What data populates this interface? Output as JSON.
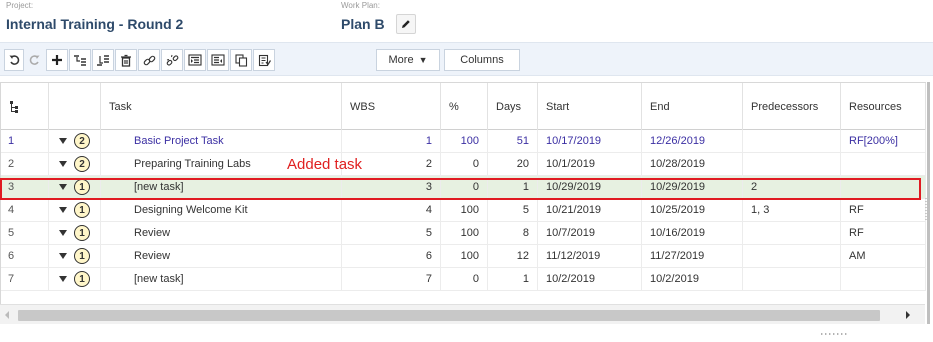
{
  "header": {
    "project_label": "Project:",
    "project_name": "Internal Training - Round 2",
    "workplan_label": "Work Plan:",
    "workplan_name": "Plan B"
  },
  "toolbar": {
    "icons": [
      "undo-icon",
      "redo-icon",
      "add-task-icon",
      "indent-icon",
      "outdent-icon",
      "delete-icon",
      "link-icon",
      "unlink-icon",
      "expand-icon",
      "collapse-icon",
      "copy-icon",
      "paste-icon"
    ],
    "more_label": "More",
    "columns_label": "Columns"
  },
  "grid": {
    "columns": [
      "Task",
      "WBS",
      "%",
      "Days",
      "Start",
      "End",
      "Predecessors",
      "Resources"
    ],
    "rows": [
      {
        "idx": "1",
        "level": "2",
        "task": "Basic Project Task",
        "wbs": "1",
        "pct": "100",
        "days": "51",
        "start": "10/17/2019",
        "end": "12/26/2019",
        "pred": "",
        "res": "RF[200%]",
        "summary": true
      },
      {
        "idx": "2",
        "level": "2",
        "task": "Preparing Training Labs",
        "wbs": "2",
        "pct": "0",
        "days": "20",
        "start": "10/1/2019",
        "end": "10/28/2019",
        "pred": "",
        "res": ""
      },
      {
        "idx": "3",
        "level": "1",
        "task": "[new task]",
        "wbs": "3",
        "pct": "0",
        "days": "1",
        "start": "10/29/2019",
        "end": "10/29/2019",
        "pred": "2",
        "res": "",
        "selected": true
      },
      {
        "idx": "4",
        "level": "1",
        "task": "Designing Welcome Kit",
        "wbs": "4",
        "pct": "100",
        "days": "5",
        "start": "10/21/2019",
        "end": "10/25/2019",
        "pred": "1, 3",
        "res": "RF"
      },
      {
        "idx": "5",
        "level": "1",
        "task": "Review",
        "wbs": "5",
        "pct": "100",
        "days": "8",
        "start": "10/7/2019",
        "end": "10/16/2019",
        "pred": "",
        "res": "RF"
      },
      {
        "idx": "6",
        "level": "1",
        "task": "Review",
        "wbs": "6",
        "pct": "100",
        "days": "12",
        "start": "11/12/2019",
        "end": "11/27/2019",
        "pred": "",
        "res": "AM"
      },
      {
        "idx": "7",
        "level": "1",
        "task": "[new task]",
        "wbs": "7",
        "pct": "0",
        "days": "1",
        "start": "10/2/2019",
        "end": "10/2/2019",
        "pred": "",
        "res": ""
      }
    ]
  },
  "annotation": {
    "text": "Added task",
    "color": "#e02020"
  },
  "colors": {
    "summary_text": "#3b2fa3",
    "selected_row": "#e7f1e1",
    "toolbar_bg": "#eef3fa",
    "badge_fill": "#fff6c9"
  }
}
